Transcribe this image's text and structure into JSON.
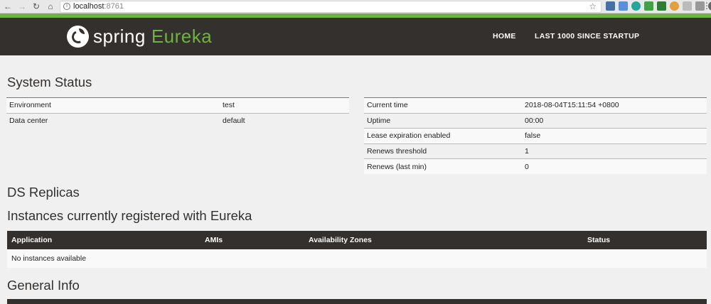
{
  "browser": {
    "url_host": "localhost",
    "url_port": ":8761"
  },
  "navbar": {
    "logo_spring": "spring",
    "logo_eureka": "Eureka",
    "links": [
      "HOME",
      "LAST 1000 SINCE STARTUP"
    ],
    "accent_color": "#6db33f",
    "background_color": "#34302d"
  },
  "system_status": {
    "title": "System Status",
    "left": [
      {
        "key": "Environment",
        "value": "test"
      },
      {
        "key": "Data center",
        "value": "default"
      }
    ],
    "right": [
      {
        "key": "Current time",
        "value": "2018-08-04T15:11:54 +0800"
      },
      {
        "key": "Uptime",
        "value": "00:00"
      },
      {
        "key": "Lease expiration enabled",
        "value": "false"
      },
      {
        "key": "Renews threshold",
        "value": "1"
      },
      {
        "key": "Renews (last min)",
        "value": "0"
      }
    ]
  },
  "ds_replicas": {
    "title": "DS Replicas"
  },
  "instances": {
    "title": "Instances currently registered with Eureka",
    "columns": [
      "Application",
      "AMIs",
      "Availability Zones",
      "Status"
    ],
    "empty_message": "No instances available"
  },
  "general_info": {
    "title": "General Info"
  }
}
